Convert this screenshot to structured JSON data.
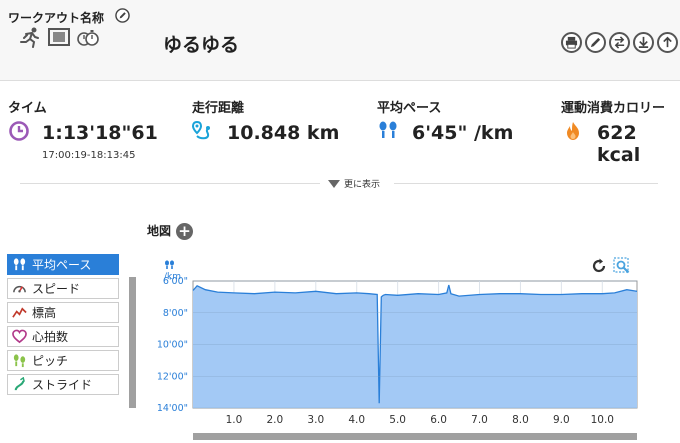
{
  "header": {
    "workout_label": "ワークアウト名称",
    "workout_name": "ゆるゆる",
    "type_icons": [
      "runner-icon",
      "film-icon",
      "stopwatch-icon"
    ],
    "toolbar_icons": [
      "print-icon",
      "edit-icon",
      "swap-icon",
      "download-icon",
      "export-icon"
    ]
  },
  "stats": [
    {
      "label": "タイム",
      "value": "1:13'18\"61",
      "sub": "17:00:19-18:13:45",
      "icon": "clock-icon",
      "color": "#9b59b6"
    },
    {
      "label": "走行距離",
      "value": "10.848 km",
      "icon": "route-icon",
      "color": "#1aa3d9"
    },
    {
      "label": "平均ペース",
      "value": "6'45\" /km",
      "icon": "footprints-icon",
      "color": "#2a7fd8"
    },
    {
      "label": "運動消費カロリー",
      "value": "622 kcal",
      "icon": "flame-icon",
      "color": "#f08a24"
    }
  ],
  "more": {
    "label": "更に表示"
  },
  "map": {
    "label": "地図"
  },
  "metrics": [
    {
      "label": "平均ペース",
      "icon": "footprints-icon",
      "active": true
    },
    {
      "label": "スピード",
      "icon": "gauge-icon",
      "active": false
    },
    {
      "label": "標高",
      "icon": "elevation-icon",
      "active": false
    },
    {
      "label": "心拍数",
      "icon": "heart-icon",
      "active": false
    },
    {
      "label": "ピッチ",
      "icon": "footprints-green-icon",
      "active": false
    },
    {
      "label": "ストライド",
      "icon": "stride-icon",
      "active": false
    }
  ],
  "colors": {
    "accent": "#2a7fd8",
    "chart_fill": "#a3c9f5",
    "chart_line": "#2a7fd8"
  },
  "chart_data": {
    "type": "area",
    "ylabel": "/km",
    "y_tick_labels": [
      "6'00\"",
      "8'00\"",
      "10'00\"",
      "12'00\"",
      "14'00\""
    ],
    "y_ticks_minutes": [
      6,
      8,
      10,
      12,
      14
    ],
    "ylim": [
      6,
      14
    ],
    "y_inverted": true,
    "x_tick_labels": [
      "1.0",
      "2.0",
      "3.0",
      "4.0",
      "5.0",
      "6.0",
      "7.0",
      "8.0",
      "9.0",
      "10.0"
    ],
    "xlim": [
      0,
      10.848
    ],
    "grid": true,
    "series": [
      {
        "x": [
          0,
          0.1,
          0.3,
          0.6,
          1.0,
          1.5,
          2.0,
          2.5,
          3.0,
          3.5,
          4.0,
          4.3,
          4.5,
          4.55,
          4.6,
          4.65,
          4.7,
          5.0,
          5.5,
          6.0,
          6.2,
          6.25,
          6.3,
          6.5,
          7.0,
          7.5,
          8.0,
          8.5,
          9.0,
          9.5,
          10.0,
          10.3,
          10.6,
          10.848
        ],
        "y": [
          6.6,
          6.3,
          6.55,
          6.7,
          6.75,
          6.8,
          6.7,
          6.75,
          6.65,
          6.8,
          6.75,
          6.8,
          6.85,
          13.7,
          7.0,
          6.9,
          6.85,
          6.9,
          6.8,
          6.85,
          6.75,
          6.25,
          6.8,
          6.95,
          6.85,
          6.8,
          6.8,
          6.85,
          6.85,
          6.8,
          6.8,
          6.75,
          6.55,
          6.65
        ]
      }
    ]
  }
}
